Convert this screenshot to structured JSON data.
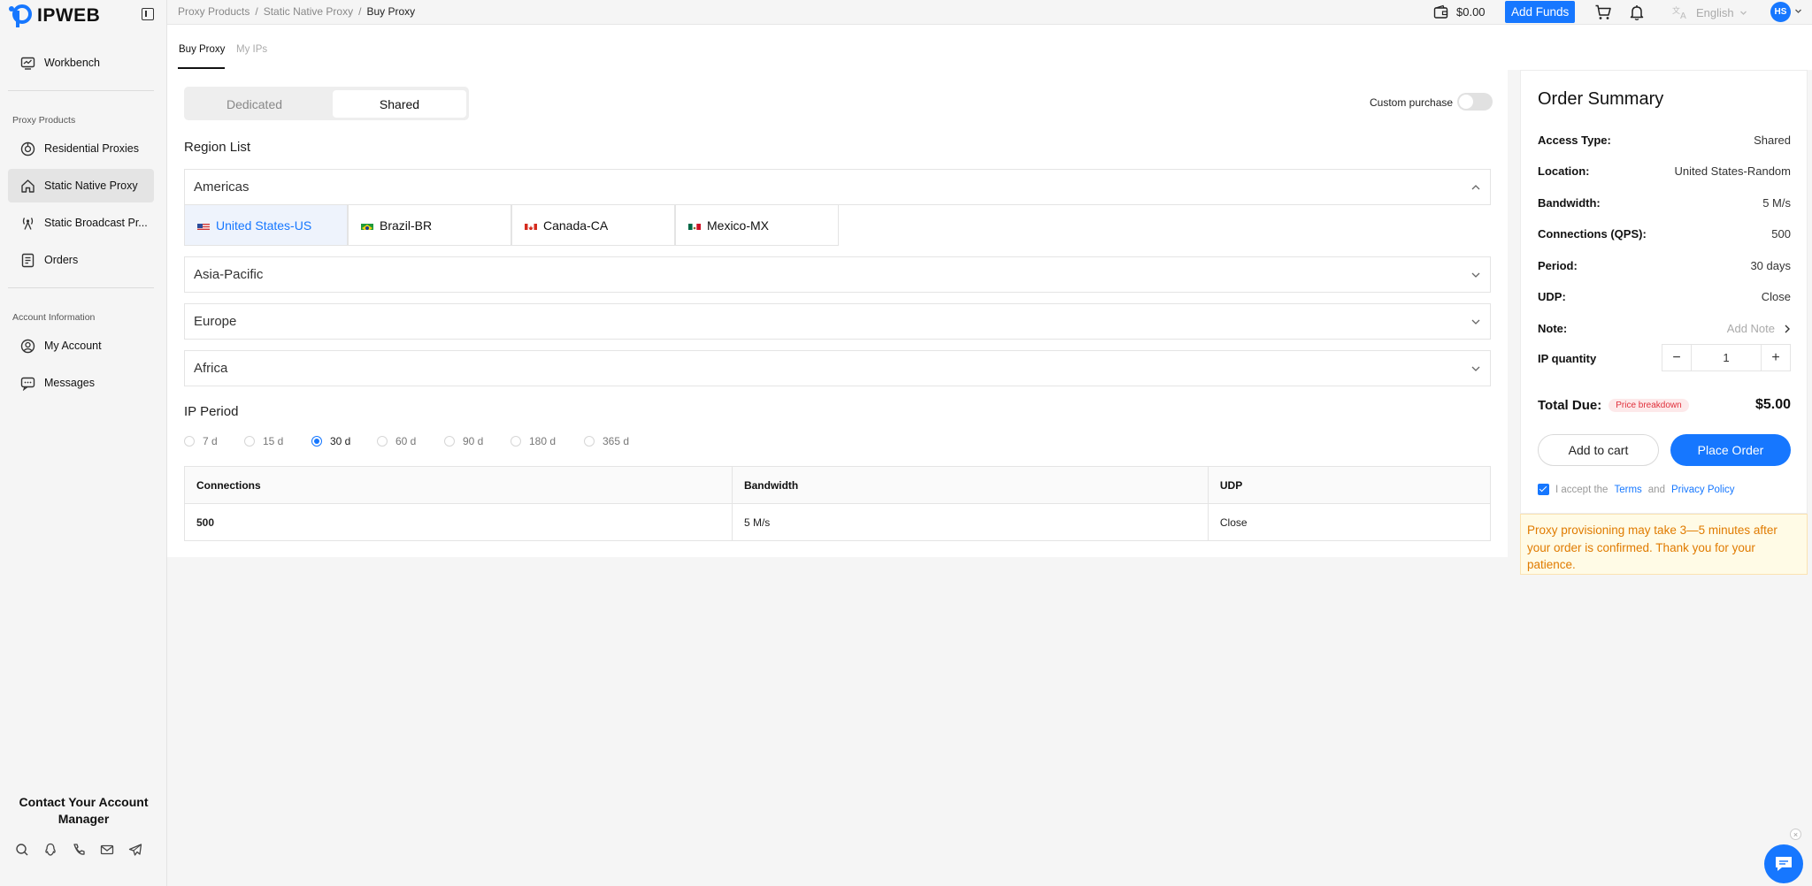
{
  "app": {
    "logo_text": "IPWEB"
  },
  "sidebar": {
    "workbench": "Workbench",
    "section_proxy": "Proxy Products",
    "items": [
      "Residential Proxies",
      "Static Native Proxy",
      "Static Broadcast Pr..."
    ],
    "orders": "Orders",
    "section_account": "Account Information",
    "my_account": "My Account",
    "messages": "Messages",
    "contact": "Contact Your Account Manager"
  },
  "header": {
    "breadcrumb": [
      "Proxy Products",
      "/",
      "Static Native Proxy",
      "/",
      "Buy Proxy"
    ],
    "balance": "$0.00",
    "add_funds": "Add Funds",
    "language": "English",
    "avatar": "HS"
  },
  "tabs": [
    "Buy Proxy",
    "My IPs"
  ],
  "main": {
    "access_types": [
      "Dedicated",
      "Shared"
    ],
    "custom_purchase": "Custom purchase",
    "region_list_label": "Region List",
    "regions": [
      "Americas",
      "Asia-Pacific",
      "Europe",
      "Africa"
    ],
    "countries": [
      "United States-US",
      "Brazil-BR",
      "Canada-CA",
      "Mexico-MX"
    ],
    "ip_period_label": "IP Period",
    "periods": [
      "7 d",
      "15 d",
      "30 d",
      "60 d",
      "90 d",
      "180 d",
      "365 d"
    ],
    "selected_period": "30 d",
    "table": {
      "headers": [
        "Connections",
        "Bandwidth",
        "UDP"
      ],
      "row": [
        "500",
        "5 M/s",
        "Close"
      ]
    }
  },
  "summary": {
    "title": "Order Summary",
    "rows": [
      {
        "k": "Access Type:",
        "v": "Shared"
      },
      {
        "k": "Location:",
        "v": "United States-Random"
      },
      {
        "k": "Bandwidth:",
        "v": "5 M/s"
      },
      {
        "k": "Connections (QPS):",
        "v": "500"
      },
      {
        "k": "Period:",
        "v": "30 days"
      },
      {
        "k": "UDP:",
        "v": "Close"
      }
    ],
    "note_label": "Note:",
    "note_value": "Add Note",
    "qty_label": "IP quantity",
    "qty": "1",
    "minus": "−",
    "plus": "+",
    "total_label": "Total Due:",
    "price_breakdown": "Price breakdown",
    "total": "$5.00",
    "add_to_cart": "Add to cart",
    "place_order": "Place Order",
    "terms_prefix": "I accept the",
    "terms_link": "Terms",
    "terms_and": "and",
    "privacy_link": "Privacy Policy",
    "notice": "Proxy provisioning may take 3—5 minutes after your order is confirmed. Thank you for your patience."
  },
  "colors": {
    "accent": "#1677ff",
    "warning": "#e07b00",
    "danger": "#e0303b"
  },
  "icons": [
    "logo-icon",
    "collapse-sidebar-icon",
    "workbench-icon",
    "residential-icon",
    "home-icon",
    "broadcast-icon",
    "orders-icon",
    "account-icon",
    "messages-icon",
    "search-icon",
    "qq-icon",
    "phone-icon",
    "mail-icon",
    "telegram-icon",
    "wallet-icon",
    "cart-icon",
    "bell-icon",
    "translate-icon",
    "chevron-down-icon",
    "chevron-up-icon",
    "chevron-right-icon",
    "chat-icon"
  ]
}
